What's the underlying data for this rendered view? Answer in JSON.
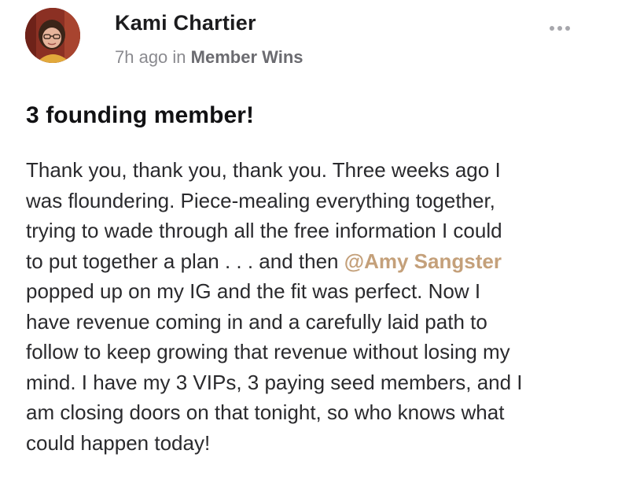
{
  "post": {
    "author": {
      "name": "Kami Chartier"
    },
    "meta": {
      "time": "7h ago",
      "in_word": "in",
      "space": "Member Wins"
    },
    "title": "3 founding member!",
    "body": {
      "line1": "Thank you, thank you, thank you. Three weeks ago I",
      "line2": "was floundering. Piece-mealing everything together,",
      "line3": "trying to wade through all the free information I could",
      "line4_before": "to put together a plan . . . and then ",
      "mention": "@Amy Sangster",
      "line5": "popped up on my IG and the fit was perfect. Now I",
      "line6": "have revenue coming in and a carefully laid path to",
      "line7": "follow to keep growing that revenue without losing my",
      "line8": "mind. I have my 3 VIPs, 3 paying seed members, and I",
      "line9": "am closing doors on that tonight, so who knows what",
      "line10": "could happen today!"
    }
  },
  "icons": {
    "more": "more-horizontal-icon"
  },
  "colors": {
    "mention": "#c4a07a",
    "meta_text": "#8a8a8f",
    "text": "#2a2a2d"
  }
}
